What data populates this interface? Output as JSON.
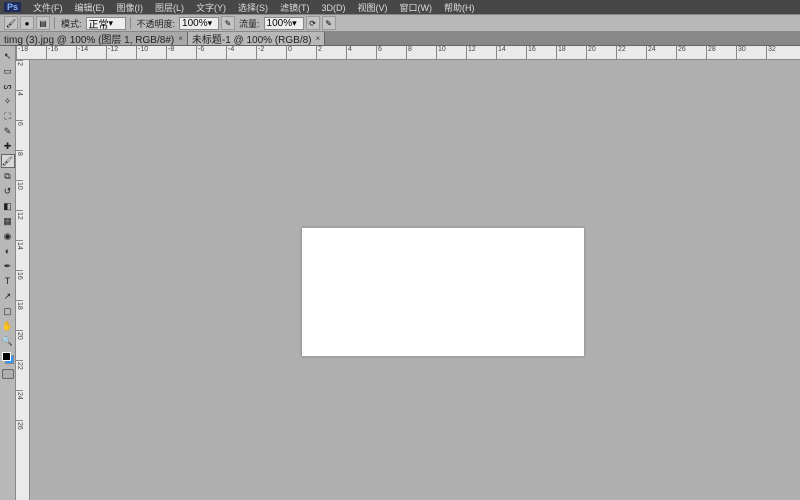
{
  "app": {
    "logo": "Ps"
  },
  "menu": [
    "文件(F)",
    "编辑(E)",
    "图像(I)",
    "图层(L)",
    "文字(Y)",
    "选择(S)",
    "滤镜(T)",
    "3D(D)",
    "视图(V)",
    "窗口(W)",
    "帮助(H)"
  ],
  "options": {
    "mode_label": "模式:",
    "mode_value": "正常",
    "opacity_label": "不透明度:",
    "opacity_value": "100%",
    "flow_label": "流量:",
    "flow_value": "100%"
  },
  "tabs": [
    {
      "label": "timg (3).jpg @ 100% (图层 1, RGB/8#)"
    },
    {
      "label": "未标题-1 @ 100% (RGB/8)"
    }
  ],
  "tools": [
    {
      "name": "move",
      "g": "↖"
    },
    {
      "name": "marquee",
      "g": "▭"
    },
    {
      "name": "lasso",
      "g": "ᔕ"
    },
    {
      "name": "magic-wand",
      "g": "✧"
    },
    {
      "name": "crop",
      "g": "⛶"
    },
    {
      "name": "eyedropper",
      "g": "✎"
    },
    {
      "name": "healing",
      "g": "✚"
    },
    {
      "name": "brush",
      "g": "🖌",
      "sel": true
    },
    {
      "name": "clone",
      "g": "⧉"
    },
    {
      "name": "history-brush",
      "g": "↺"
    },
    {
      "name": "eraser",
      "g": "◧"
    },
    {
      "name": "gradient",
      "g": "▦"
    },
    {
      "name": "blur",
      "g": "◉"
    },
    {
      "name": "dodge",
      "g": "◐"
    },
    {
      "name": "pen",
      "g": "✒"
    },
    {
      "name": "type",
      "g": "T"
    },
    {
      "name": "path-select",
      "g": "↗"
    },
    {
      "name": "rectangle",
      "g": "▢"
    },
    {
      "name": "hand",
      "g": "✋"
    },
    {
      "name": "zoom",
      "g": "🔍"
    }
  ],
  "ruler_h": [
    -18,
    -16,
    -14,
    -12,
    -10,
    -8,
    -6,
    -4,
    -2,
    0,
    2,
    4,
    6,
    8,
    10,
    12,
    14,
    16,
    18,
    20,
    22,
    24,
    26,
    28,
    30,
    32
  ],
  "ruler_v": [
    2,
    4,
    6,
    8,
    10,
    12,
    14,
    16,
    18,
    20,
    22,
    24,
    26
  ]
}
